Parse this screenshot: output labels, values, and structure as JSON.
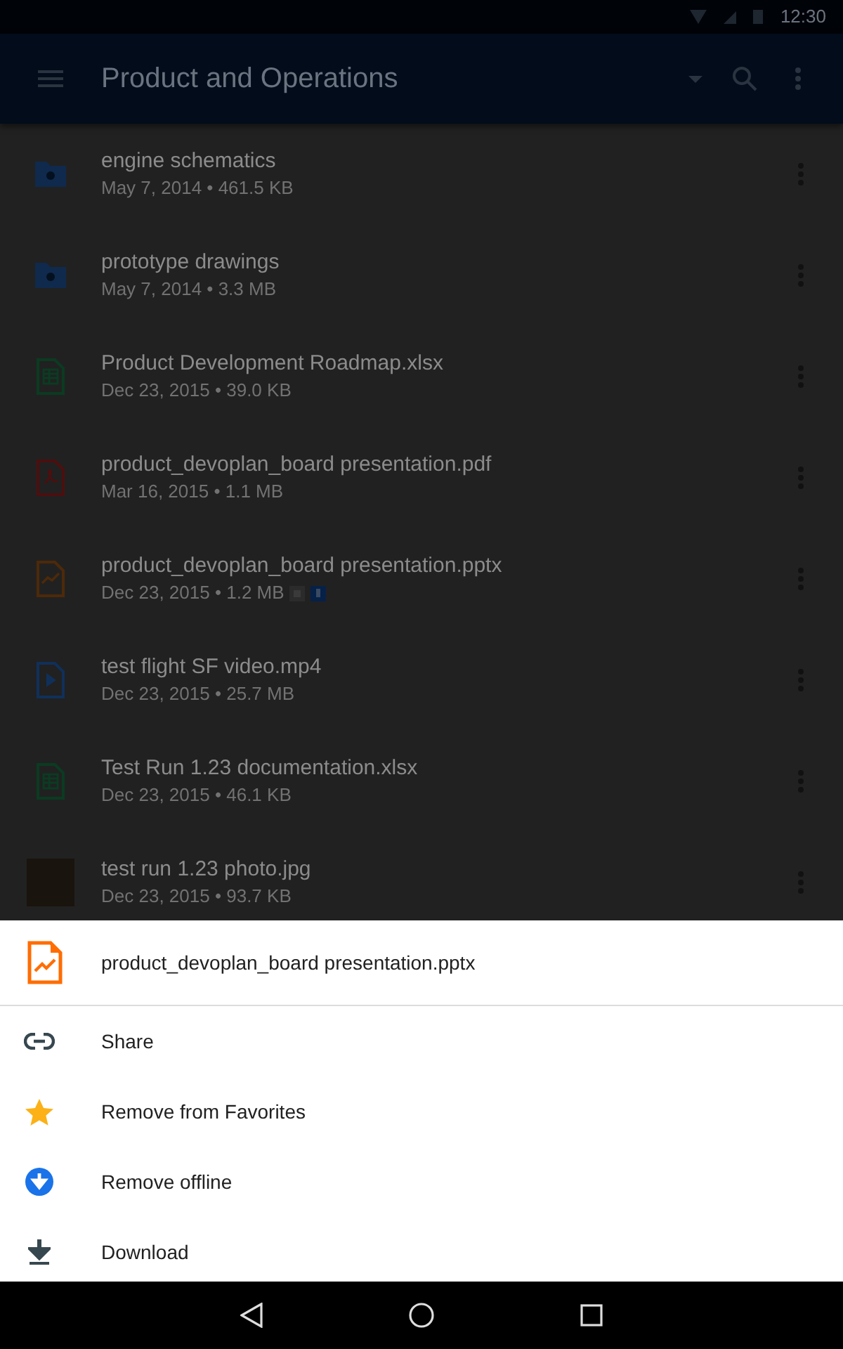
{
  "status_bar": {
    "time": "12:30"
  },
  "app_bar": {
    "title": "Product and Operations"
  },
  "files": [
    {
      "kind": "folder",
      "name": "engine schematics",
      "details": "May 7, 2014 • 461.5 KB",
      "starred": false,
      "offline": false
    },
    {
      "kind": "folder",
      "name": "prototype drawings",
      "details": "May 7, 2014 • 3.3 MB",
      "starred": false,
      "offline": false
    },
    {
      "kind": "sheet",
      "name": "Product Development Roadmap.xlsx",
      "details": "Dec 23, 2015 • 39.0 KB",
      "starred": false,
      "offline": false
    },
    {
      "kind": "pdf",
      "name": "product_devoplan_board presentation.pdf",
      "details": "Mar 16, 2015 • 1.1 MB",
      "starred": false,
      "offline": false
    },
    {
      "kind": "slides",
      "name": "product_devoplan_board presentation.pptx",
      "details": "Dec 23, 2015 • 1.2 MB",
      "starred": true,
      "offline": true
    },
    {
      "kind": "video",
      "name": "test flight SF video.mp4",
      "details": "Dec 23, 2015 • 25.7 MB",
      "starred": false,
      "offline": false
    },
    {
      "kind": "sheet",
      "name": "Test Run 1.23 documentation.xlsx",
      "details": "Dec 23, 2015 • 46.1 KB",
      "starred": false,
      "offline": false
    },
    {
      "kind": "photo",
      "name": "test run 1.23 photo.jpg",
      "details": "Dec 23, 2015 • 93.7 KB",
      "starred": false,
      "offline": false
    }
  ],
  "sheet": {
    "file_name": "product_devoplan_board presentation.pptx",
    "actions": [
      {
        "kind": "share",
        "label": "Share"
      },
      {
        "kind": "star",
        "label": "Remove from Favorites"
      },
      {
        "kind": "offline",
        "label": "Remove offline"
      },
      {
        "kind": "download",
        "label": "Download"
      }
    ]
  }
}
